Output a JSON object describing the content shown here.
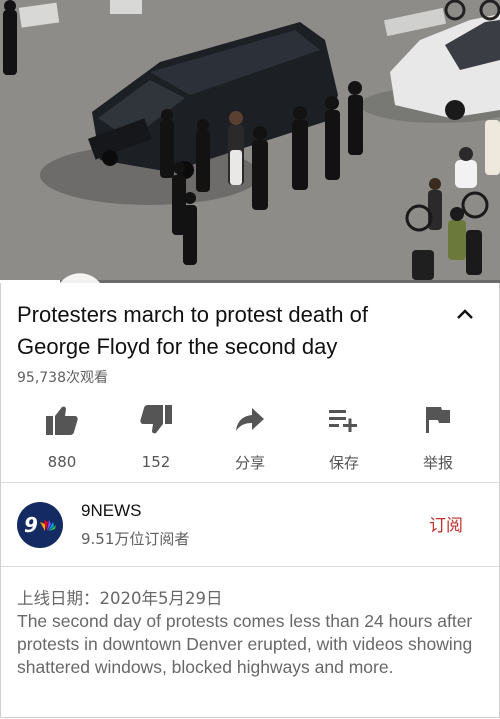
{
  "video": {
    "alt": "protest-scene-thumbnail"
  },
  "header": {
    "title": "Protesters march to protest death of George Floyd for the second day",
    "views": "95,738次观看"
  },
  "actions": [
    {
      "icon": "thumbs-up-icon",
      "label": "880"
    },
    {
      "icon": "thumbs-down-icon",
      "label": "152"
    },
    {
      "icon": "share-icon",
      "label": "分享"
    },
    {
      "icon": "save-playlist-icon",
      "label": "保存"
    },
    {
      "icon": "flag-icon",
      "label": "举报"
    }
  ],
  "channel": {
    "name": "9NEWS",
    "subscribers": "9.51万位订阅者",
    "subscribe_label": "订阅",
    "avatar_text": "9"
  },
  "description": {
    "date": "上线日期：2020年5月29日",
    "text": "The second day of protests comes less than 24 hours after protests in downtown Denver erupted, with videos showing shattered windows, blocked highways and more."
  },
  "colors": {
    "accent": "#c4302b",
    "avatar_bg": "#142a62",
    "icon_gray": "#555555"
  }
}
